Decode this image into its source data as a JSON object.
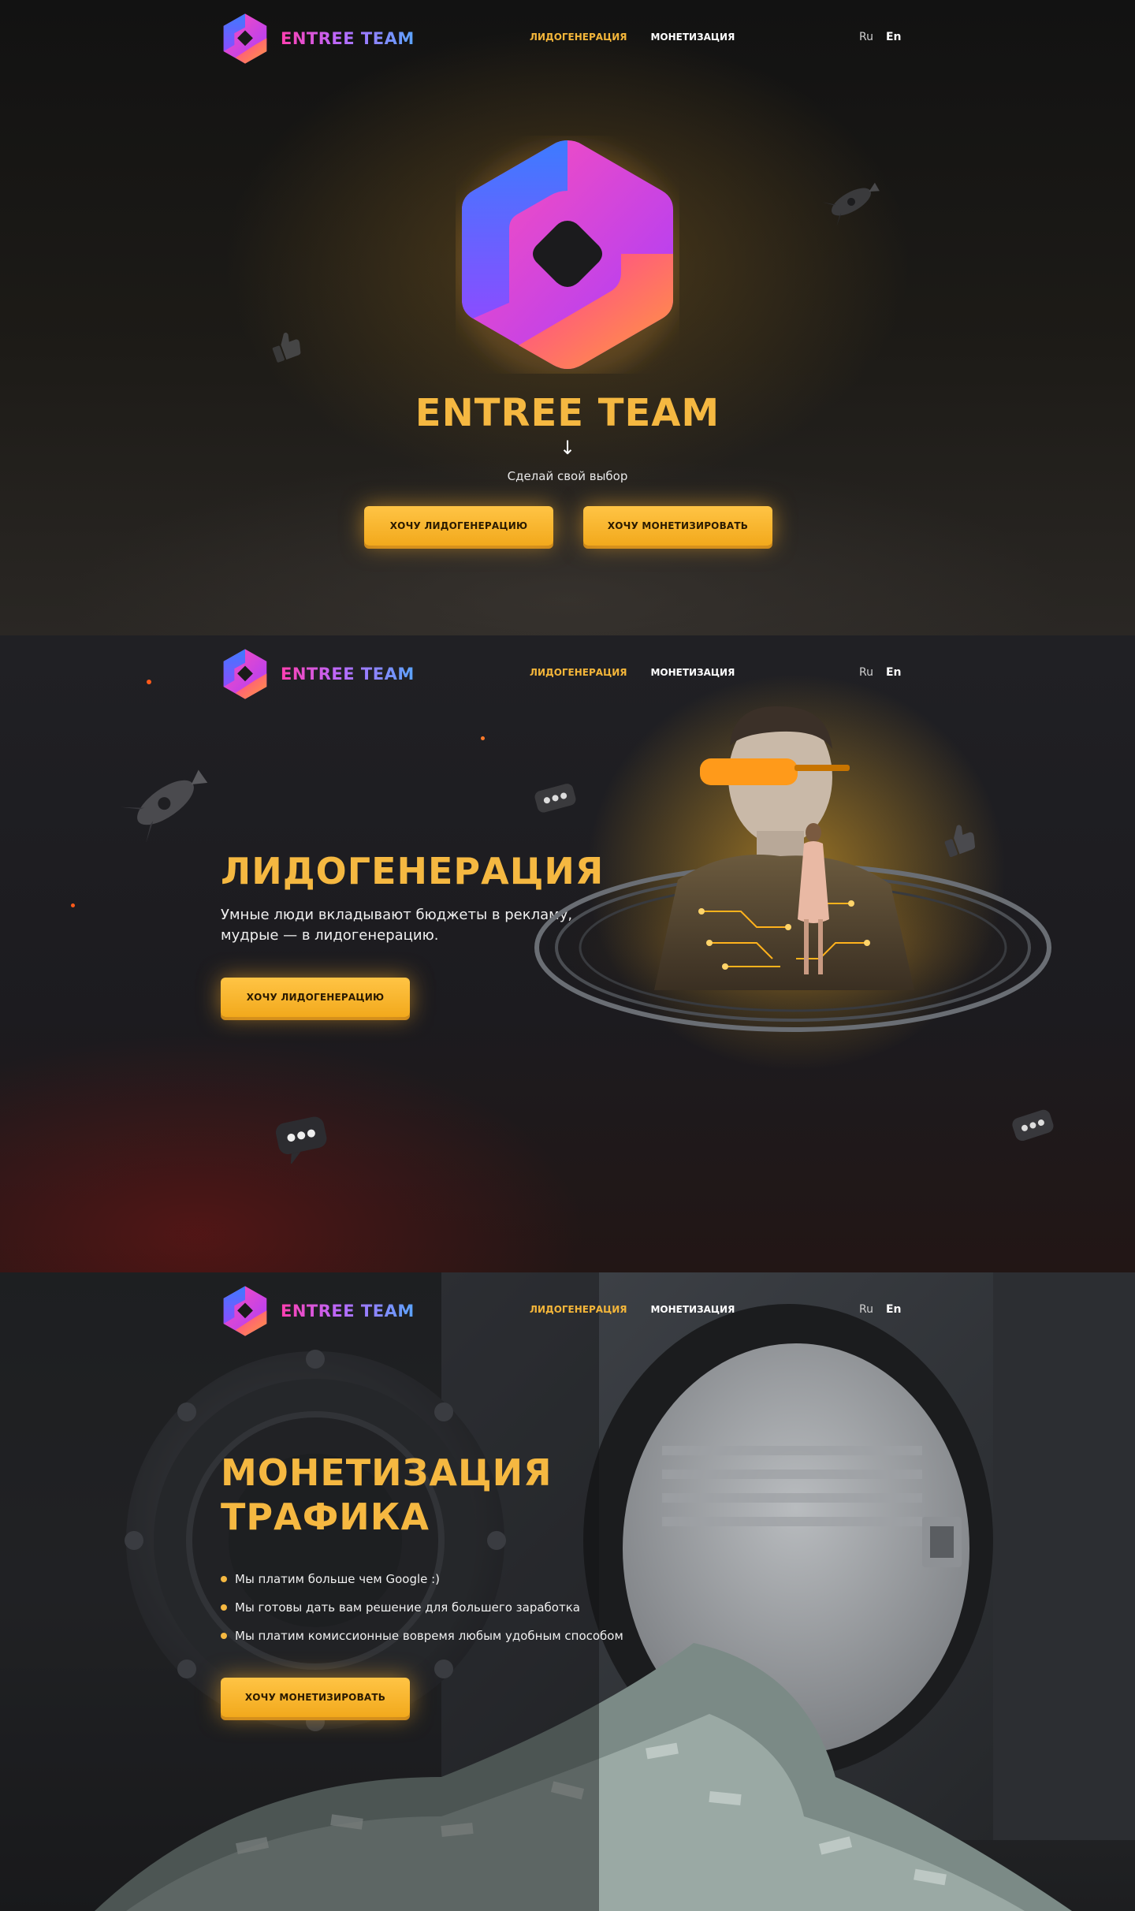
{
  "brand": {
    "name": "ENTREE TEAM",
    "logo_icon": "hexagon-logo-icon"
  },
  "nav": {
    "items": [
      {
        "label": "ЛИДОГЕНЕРАЦИЯ",
        "active": true
      },
      {
        "label": "МОНЕТИЗАЦИЯ",
        "active": false
      }
    ]
  },
  "lang": {
    "ru": "Ru",
    "en": "En",
    "selected": "En"
  },
  "hero": {
    "title": "ENTREE TEAM",
    "arrow": "↓",
    "subtitle": "Сделай свой выбор",
    "btn_leadgen": "ХОЧУ ЛИДОГЕНЕРАЦИЮ",
    "btn_monetize": "ХОЧУ МОНЕТИЗИРОВАТЬ"
  },
  "leadgen": {
    "title": "ЛИДОГЕНЕРАЦИЯ",
    "text": "Умные люди вкладывают бюджеты в рекламу, мудрые — в лидогенерацию.",
    "button": "ХОЧУ ЛИДОГЕНЕРАЦИЮ"
  },
  "monetization": {
    "title": "МОНЕТИЗАЦИЯ ТРАФИКА",
    "bullets": [
      "Мы платим больше чем Google :)",
      "Мы готовы дать вам решение для большего заработка",
      "Мы платим комиссионные вовремя любым удобным способом"
    ],
    "button": "ХОЧУ МОНЕТИЗИРОВАТЬ"
  },
  "colors": {
    "accent": "#f5b841",
    "button": "#f2a91c",
    "brand_gradient": [
      "#ff3fb0",
      "#b86bff",
      "#5aa4ff"
    ]
  }
}
